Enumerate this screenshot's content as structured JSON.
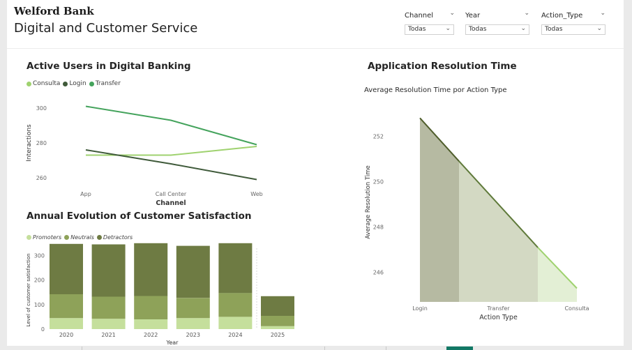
{
  "header": {
    "bank_name": "Welford Bank",
    "title": "Digital and Customer Service"
  },
  "filters": [
    {
      "label": "Channel",
      "value": "Todas"
    },
    {
      "label": "Year",
      "value": "Todas"
    },
    {
      "label": "Action_Type",
      "value": "Todas"
    }
  ],
  "colors": {
    "consulta": "#9fd26f",
    "login": "#3f5a3a",
    "transfer": "#44a35c",
    "promoters": "#c5df9c",
    "neutrals": "#8ea259",
    "detractors": "#6e7b43",
    "area_dark": "#4f5d2b",
    "tab_active": "#117865"
  },
  "active_users": {
    "title": "Active Users in Digital Banking",
    "legend": [
      "Consulta",
      "Login",
      "Transfer"
    ],
    "chart_data": {
      "type": "line",
      "x": [
        "App",
        "Call Center",
        "Web"
      ],
      "series": [
        {
          "name": "Consulta",
          "values": [
            273,
            273,
            278
          ]
        },
        {
          "name": "Login",
          "values": [
            276,
            268,
            259
          ]
        },
        {
          "name": "Transfer",
          "values": [
            301,
            293,
            279
          ]
        }
      ],
      "xlabel": "Channel",
      "ylabel": "Interactions",
      "yticks": [
        260,
        280,
        300
      ],
      "ylim": [
        254,
        306
      ],
      "legend_position": "top-left"
    }
  },
  "satisfaction": {
    "title": "Annual Evolution of Customer Satisfaction",
    "legend": [
      "Promoters",
      "Neutrals",
      "Detractors"
    ],
    "chart_data": {
      "type": "bar",
      "stacked": true,
      "categories": [
        "2020",
        "2021",
        "2022",
        "2023",
        "2024",
        "2025"
      ],
      "series": [
        {
          "name": "Promoters",
          "values": [
            45,
            42,
            40,
            45,
            50,
            12
          ]
        },
        {
          "name": "Neutrals",
          "values": [
            97,
            90,
            95,
            82,
            97,
            42
          ]
        },
        {
          "name": "Detractors",
          "values": [
            205,
            213,
            215,
            212,
            203,
            80
          ]
        }
      ],
      "xlabel": "Year",
      "ylabel": "Level of customer satisfaction",
      "yticks": [
        0,
        100,
        200,
        300
      ],
      "ylim": [
        0,
        355
      ],
      "legend_position": "top-left"
    }
  },
  "resolution": {
    "title": "Application Resolution Time",
    "subtitle": "Average Resolution Time por Action Type",
    "chart_data": {
      "type": "area",
      "categories": [
        "Login",
        "Transfer",
        "Consulta"
      ],
      "values": [
        252.8,
        245.3
      ],
      "segments": [
        {
          "x_start": "Login",
          "x_end": "Transfer",
          "y_start": 252.8,
          "y_end": 250.9
        },
        {
          "x_start": "Transfer",
          "x_end": "Consulta",
          "y_start": 250.9,
          "y_end": 247.1
        },
        {
          "x_start": "Consulta",
          "x_end": "Consulta",
          "y_start": 247.1,
          "y_end": 245.3
        }
      ],
      "xlabel": "Action Type",
      "ylabel": "Average Resolution Time",
      "yticks": [
        246,
        248,
        250,
        252
      ],
      "ylim": [
        244.7,
        253.7
      ]
    }
  }
}
